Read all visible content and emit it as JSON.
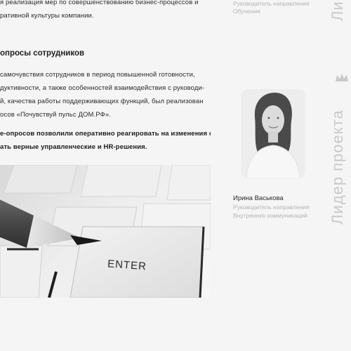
{
  "intro": {
    "lines": [
      "я реализация мер по совершенствованию бизнес-процессов и",
      "ративной культуры компании."
    ]
  },
  "section": {
    "heading": "опросы сотрудников",
    "paragraph1": [
      "самочувствия сотрудников в период повышенной готовности,",
      "дуктивности, а также особенностей взаимодействия с руководи-",
      "й, качества работы поддерживающих функций, был реализован",
      "осов «Почувствуй пульс ДОМ.РФ»."
    ],
    "paragraph2": [
      "е-опросов позволили оперативно реагировать на изменения си-",
      "ать верные управленческие и HR-решения."
    ]
  },
  "keyboard_photo": {
    "key_label": "ENTER"
  },
  "person_top": {
    "role_lines": [
      "Руководитель направления",
      "Обучения"
    ]
  },
  "person_bottom": {
    "name": "Ирина Васькова",
    "role_lines": [
      "Руководитель направления",
      "Внутренних коммуникаций"
    ]
  },
  "vertical_labels": {
    "top": "Ли",
    "bottom": "Лидер проекта"
  }
}
